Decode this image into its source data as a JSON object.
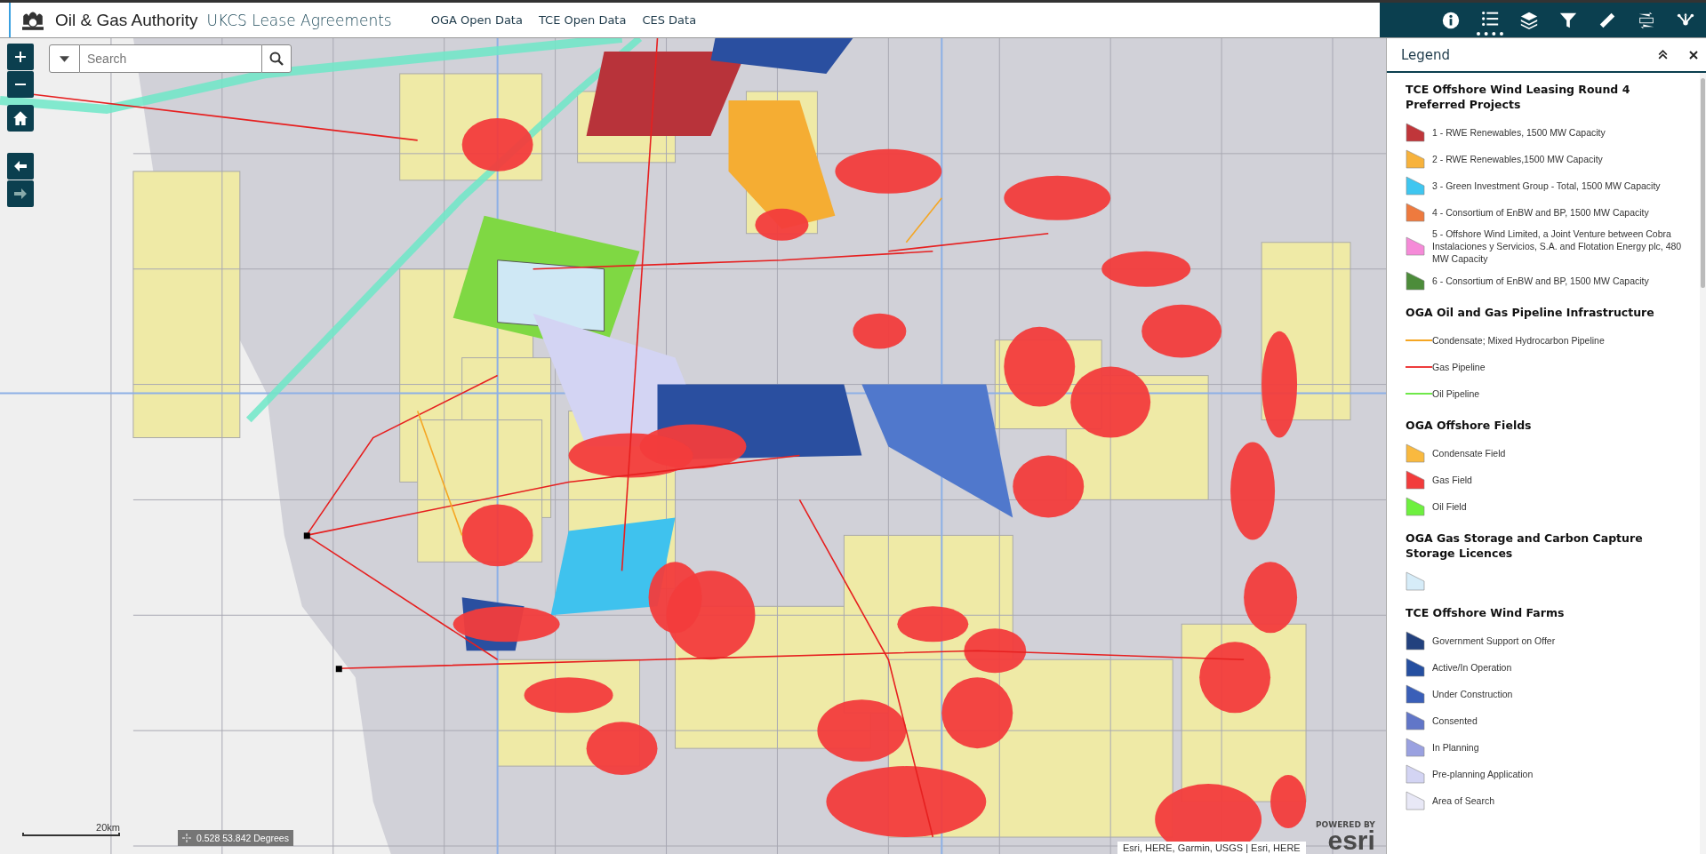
{
  "header": {
    "organisation": "Oil & Gas Authority",
    "app_title": "UKCS Lease Agreements",
    "links": [
      {
        "label": "OGA Open Data"
      },
      {
        "label": "TCE Open Data"
      },
      {
        "label": "CES Data"
      }
    ]
  },
  "toolbar": {
    "tools": [
      {
        "kind": "info",
        "selected": false
      },
      {
        "kind": "legend",
        "selected": true
      },
      {
        "kind": "layers",
        "selected": false
      },
      {
        "kind": "filter",
        "selected": false
      },
      {
        "kind": "measure",
        "selected": false
      },
      {
        "kind": "coordinates",
        "selected": false
      },
      {
        "kind": "share",
        "selected": false
      }
    ]
  },
  "legend": {
    "title": "Legend",
    "sections": [
      {
        "title": "TCE Offshore Wind Leasing Round 4 Preferred Projects",
        "items": [
          {
            "kind": "polygon",
            "label": "1 - RWE Renewables, 1500 MW Capacity",
            "color": "#c0363a"
          },
          {
            "kind": "polygon",
            "label": "2 - RWE Renewables,1500 MW Capacity",
            "color": "#f7b23c"
          },
          {
            "kind": "polygon",
            "label": "3 - Green Investment Group - Total, 1500 MW Capacity",
            "color": "#3fc6f0"
          },
          {
            "kind": "polygon",
            "label": "4 - Consortium of EnBW and BP, 1500 MW Capacity",
            "color": "#ee7a3e"
          },
          {
            "kind": "polygon",
            "label": "5 - Offshore Wind Limited, a Joint Venture between Cobra Instalaciones y Servicios, S.A. and Flotation Energy plc, 480 MW Capacity",
            "color": "#f58ad8"
          },
          {
            "kind": "polygon",
            "label": "6 - Consortium of EnBW and BP, 1500 MW Capacity",
            "color": "#4c8c3a"
          }
        ]
      },
      {
        "title": "OGA Oil and Gas Pipeline Infrastructure",
        "items": [
          {
            "kind": "line",
            "label": "Condensate; Mixed Hydrocarbon Pipeline",
            "color": "#f5a623"
          },
          {
            "kind": "line",
            "label": "Gas Pipeline",
            "color": "#ee3b3b"
          },
          {
            "kind": "line",
            "label": "Oil Pipeline",
            "color": "#6fe84a"
          }
        ]
      },
      {
        "title": "OGA Offshore Fields",
        "items": [
          {
            "kind": "polygon",
            "label": "Condensate Field",
            "color": "#f9b93f"
          },
          {
            "kind": "polygon",
            "label": "Gas Field",
            "color": "#f23c3c"
          },
          {
            "kind": "polygon",
            "label": "Oil Field",
            "color": "#6ef03f"
          }
        ]
      },
      {
        "title": "OGA Gas Storage and Carbon Capture Storage Licences",
        "items": [
          {
            "kind": "polygon",
            "color": "#d6ecf8"
          }
        ]
      },
      {
        "title": "TCE Offshore Wind Farms",
        "items": [
          {
            "kind": "polygon",
            "label": "Government Support on Offer",
            "color": "#22417e"
          },
          {
            "kind": "polygon",
            "label": "Active/In Operation",
            "color": "#254fa0"
          },
          {
            "kind": "polygon",
            "label": "Under Construction",
            "color": "#3a5fb8"
          },
          {
            "kind": "polygon",
            "label": "Consented",
            "color": "#6176c8"
          },
          {
            "kind": "polygon",
            "label": "In Planning",
            "color": "#9aa1e0"
          },
          {
            "kind": "polygon",
            "label": "Pre-planning Application",
            "color": "#d3d4f3"
          },
          {
            "kind": "polygon",
            "label": "Area of Search",
            "color": "#e8e8f6"
          }
        ]
      }
    ]
  },
  "map": {
    "search": {
      "placeholder": "Search"
    },
    "scale": "20km",
    "coordinates": "0.528 53.842 Degrees",
    "attribution": "Esri, HERE, Garmin, USGS | Esri, HERE",
    "powered_by": "POWERED BY",
    "logo": "esri"
  }
}
